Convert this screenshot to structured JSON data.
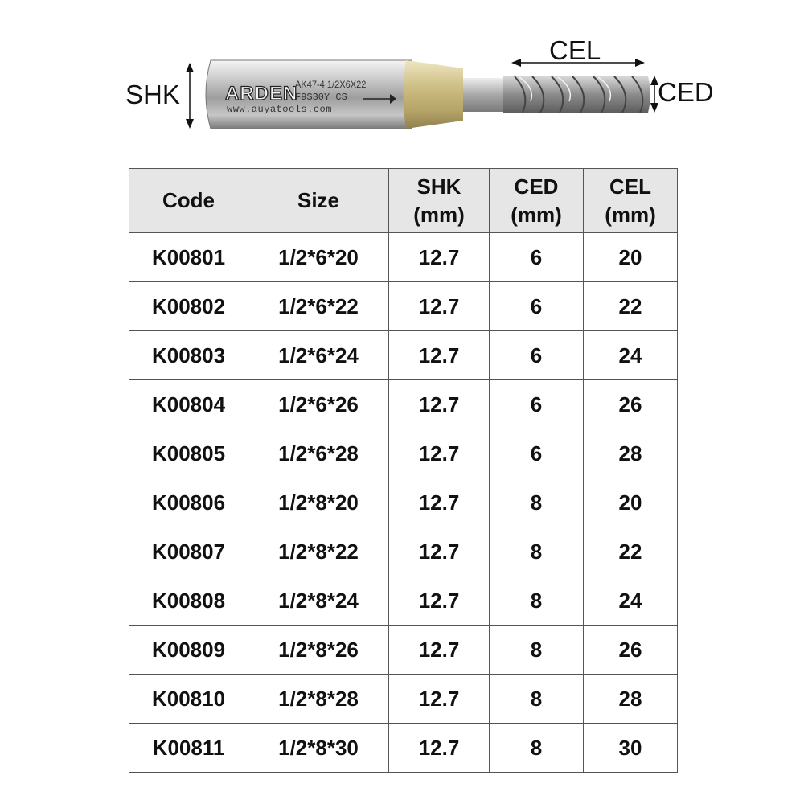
{
  "diagram": {
    "labels": {
      "shk": "SHK",
      "cel": "CEL",
      "ced": "CED"
    },
    "tool_markings": {
      "brand": "ARDEN",
      "line1": "AK47-4 1/2X6X22",
      "line2": "F9S30Y CS",
      "line3": "www.auyatools.com"
    }
  },
  "table": {
    "headers": [
      {
        "line1": "Code",
        "line2": ""
      },
      {
        "line1": "Size",
        "line2": ""
      },
      {
        "line1": "SHK",
        "line2": "(mm)"
      },
      {
        "line1": "CED",
        "line2": "(mm)"
      },
      {
        "line1": "CEL",
        "line2": "(mm)"
      }
    ],
    "rows": [
      [
        "K00801",
        "1/2*6*20",
        "12.7",
        "6",
        "20"
      ],
      [
        "K00802",
        "1/2*6*22",
        "12.7",
        "6",
        "22"
      ],
      [
        "K00803",
        "1/2*6*24",
        "12.7",
        "6",
        "24"
      ],
      [
        "K00804",
        "1/2*6*26",
        "12.7",
        "6",
        "26"
      ],
      [
        "K00805",
        "1/2*6*28",
        "12.7",
        "6",
        "28"
      ],
      [
        "K00806",
        "1/2*8*20",
        "12.7",
        "8",
        "20"
      ],
      [
        "K00807",
        "1/2*8*22",
        "12.7",
        "8",
        "22"
      ],
      [
        "K00808",
        "1/2*8*24",
        "12.7",
        "8",
        "24"
      ],
      [
        "K00809",
        "1/2*8*26",
        "12.7",
        "8",
        "26"
      ],
      [
        "K00810",
        "1/2*8*28",
        "12.7",
        "8",
        "28"
      ],
      [
        "K00811",
        "1/2*8*30",
        "12.7",
        "8",
        "30"
      ]
    ]
  }
}
